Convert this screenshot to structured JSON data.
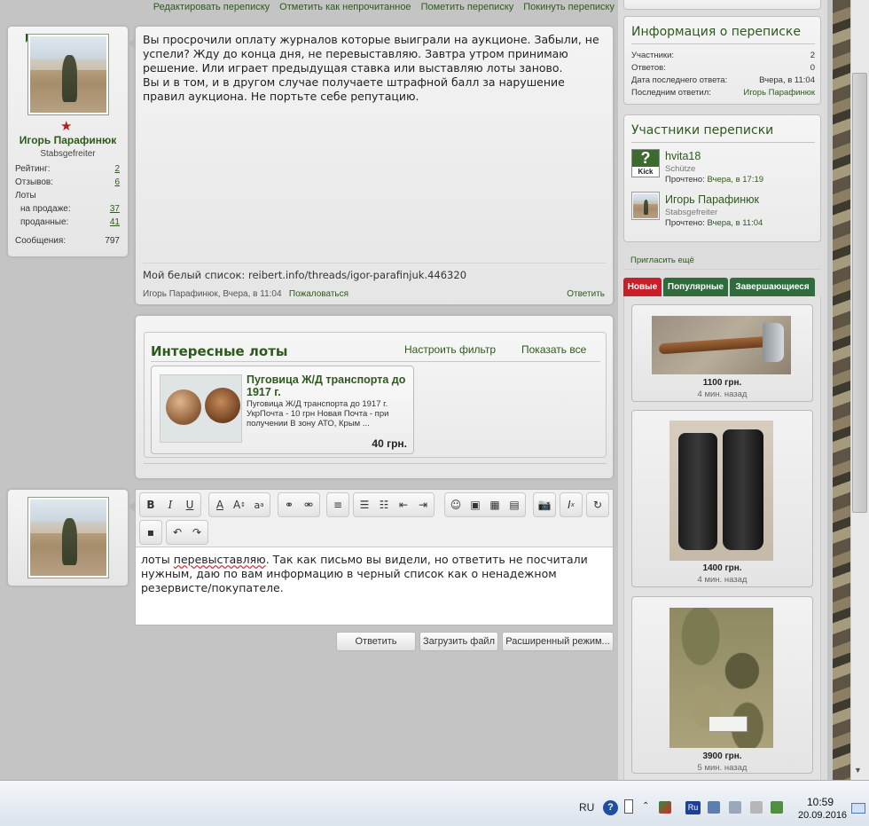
{
  "topnav": {
    "edit": "Редактировать переписку",
    "mark_unread": "Отметить как непрочитанное",
    "tag": "Пометить переписку",
    "leave": "Покинуть переписку"
  },
  "author": {
    "name": "Игорь Парафинюк",
    "rank": "Stabsgefreiter",
    "rating_label": "Рейтинг:",
    "rating": "2",
    "reviews_label": "Отзывов:",
    "reviews": "6",
    "lots_label": "Лоты",
    "on_sale_label": "на продаже:",
    "on_sale": "37",
    "sold_label": "проданные:",
    "sold": "41",
    "messages_label": "Сообщения:",
    "messages": "797"
  },
  "message": {
    "text": "Вы просрочили оплату журналов которые выиграли на аукционе. Забыли, не успели? Жду до конца дня, не перевыставляю. Завтра утром принимаю решение. Или играет предыдущая ставка или выставляю лоты заново.\nВы и в том, и в другом случае получаете штрафной балл за нарушение правил аукциона. Не портьте себе репутацию.",
    "signature": "Мой белый список: reibert.info/threads/igor-parafinjuk.446320",
    "meta_author": "Игорь Парафинюк,",
    "meta_date": "Вчера, в 11:04",
    "report": "Пожаловаться",
    "reply": "Ответить"
  },
  "interesting_lots": {
    "title": "Интересные лоты",
    "filter": "Настроить фильтр",
    "show_all": "Показать все",
    "item": {
      "title": "Пуговица Ж/Д транспорта до 1917 г.",
      "desc": "Пуговица Ж/Д транспорта до 1917 г. УкрПочта - 10 грн Новая Почта - при получении В зону АТО, Крым ...",
      "price": "40 грн."
    }
  },
  "editor": {
    "text_before": "лоты ",
    "text_misspelled": "перевыставляю",
    "text_after": ". Так как письмо вы видели, но ответить не посчитали нужным, даю по вам информацию в черный список как о ненадежном резервисте/покупателе.",
    "btn_reply": "Ответить",
    "btn_upload": "Загрузить файл",
    "btn_advanced": "Расширенный режим..."
  },
  "info": {
    "title": "Информация о переписке",
    "participants_label": "Участники:",
    "participants": "2",
    "replies_label": "Ответов:",
    "replies": "0",
    "last_date_label": "Дата последнего ответа:",
    "last_date": "Вчера, в 11:04",
    "last_by_label": "Последним ответил:",
    "last_by": "Игорь Парафинюк"
  },
  "participants": {
    "title": "Участники переписки",
    "list": [
      {
        "name": "hvita18",
        "rank": "Schütze",
        "read_label": "Прочтено:",
        "read": "Вчера, в 17:19",
        "avatar_text": "Kick"
      },
      {
        "name": "Игорь Парафинюк",
        "rank": "Stabsgefreiter",
        "read_label": "Прочтено:",
        "read": "Вчера, в 11:04"
      }
    ],
    "invite": "Пригласить ещё"
  },
  "tabs": [
    "Новые",
    "Популярные",
    "Завершающиеся"
  ],
  "side_lots": [
    {
      "price": "1100 грн.",
      "time": "4 мин. назад"
    },
    {
      "price": "1400 грн.",
      "time": "4 мин. назад"
    },
    {
      "price": "3900 грн.",
      "time": "5 мин. назад"
    }
  ],
  "taskbar": {
    "lang": "RU",
    "time": "10:59",
    "date": "20.09.2016"
  },
  "colors": {
    "accent_green": "#2d5a1b",
    "tab_active": "#c8202a",
    "tab_inactive": "#2f6b3c"
  }
}
